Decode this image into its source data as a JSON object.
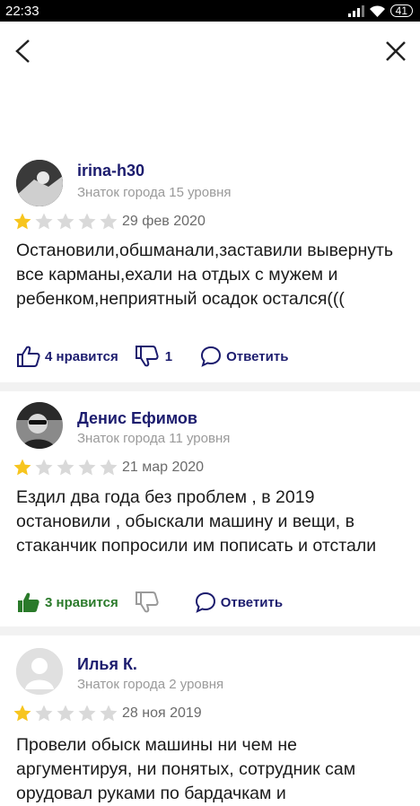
{
  "status_bar": {
    "time": "22:33",
    "battery": "41"
  },
  "reviews": [
    {
      "author": "irina-h30",
      "badge": "Знаток города 15 уровня",
      "rating": 1,
      "date": "29 фев 2020",
      "text": "Остановили,обшманали,заставили вывернуть все карманы,ехали на отдых с мужем и ребенком,неприятный осадок остался(((",
      "likes_label": "4 нравится",
      "dislikes": "1",
      "reply_label": "Ответить",
      "liked": false
    },
    {
      "author": "Денис Ефимов",
      "badge": "Знаток города 11 уровня",
      "rating": 1,
      "date": "21 мар 2020",
      "text": "Ездил два года без проблем , в 2019 остановили , обыскали машину и вещи, в стаканчик попросили им пописать и отстали",
      "likes_label": "3 нравится",
      "dislikes": "",
      "reply_label": "Ответить",
      "liked": true
    },
    {
      "author": "Илья К.",
      "badge": "Знаток города 2 уровня",
      "rating": 1,
      "date": "28 ноя 2019",
      "text": "Провели обыск машины ни чем не аргументируя, ни понятых, сотрудник сам орудовал руками по бардачкам и",
      "liked": false
    }
  ],
  "colors": {
    "star_filled": "#f7c51e",
    "star_empty": "#d9d9d9",
    "action": "#1c1c6e",
    "liked": "#2a7a2a"
  }
}
